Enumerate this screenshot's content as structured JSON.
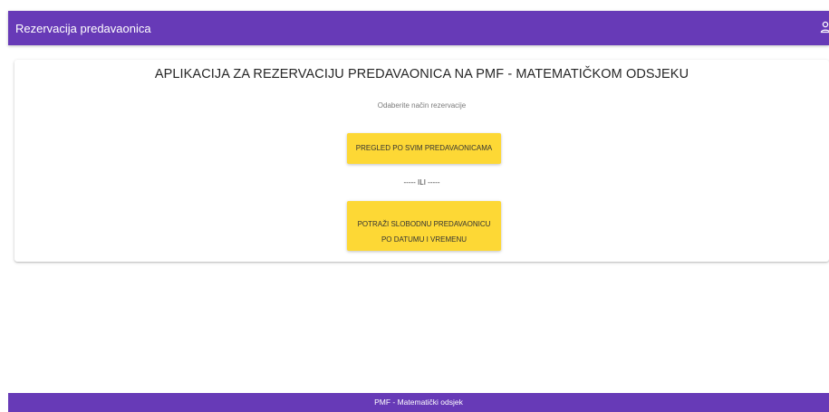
{
  "app": {
    "title": "Rezervacija predavaonica",
    "accent_color": "#673ab7",
    "button_color": "#fdd835"
  },
  "header": {
    "user_icon": "user-icon"
  },
  "main": {
    "title": "APLIKACIJA ZA REZERVACIJU PREDAVAONICA NA PMF - MATEMATIČKOM ODSJEKU",
    "subtitle": "Odaberite način rezervacije",
    "browse_button": "PREGLED PO SVIM PREDAVAONICAMA",
    "separator": "----- ILI -----",
    "search_button_line1": "POTRAŽI SLOBODNU PREDAVAONICU",
    "search_button_line2": "PO DATUMU I VREMENU"
  },
  "footer": {
    "text": "PMF - Matematički odsjek"
  }
}
